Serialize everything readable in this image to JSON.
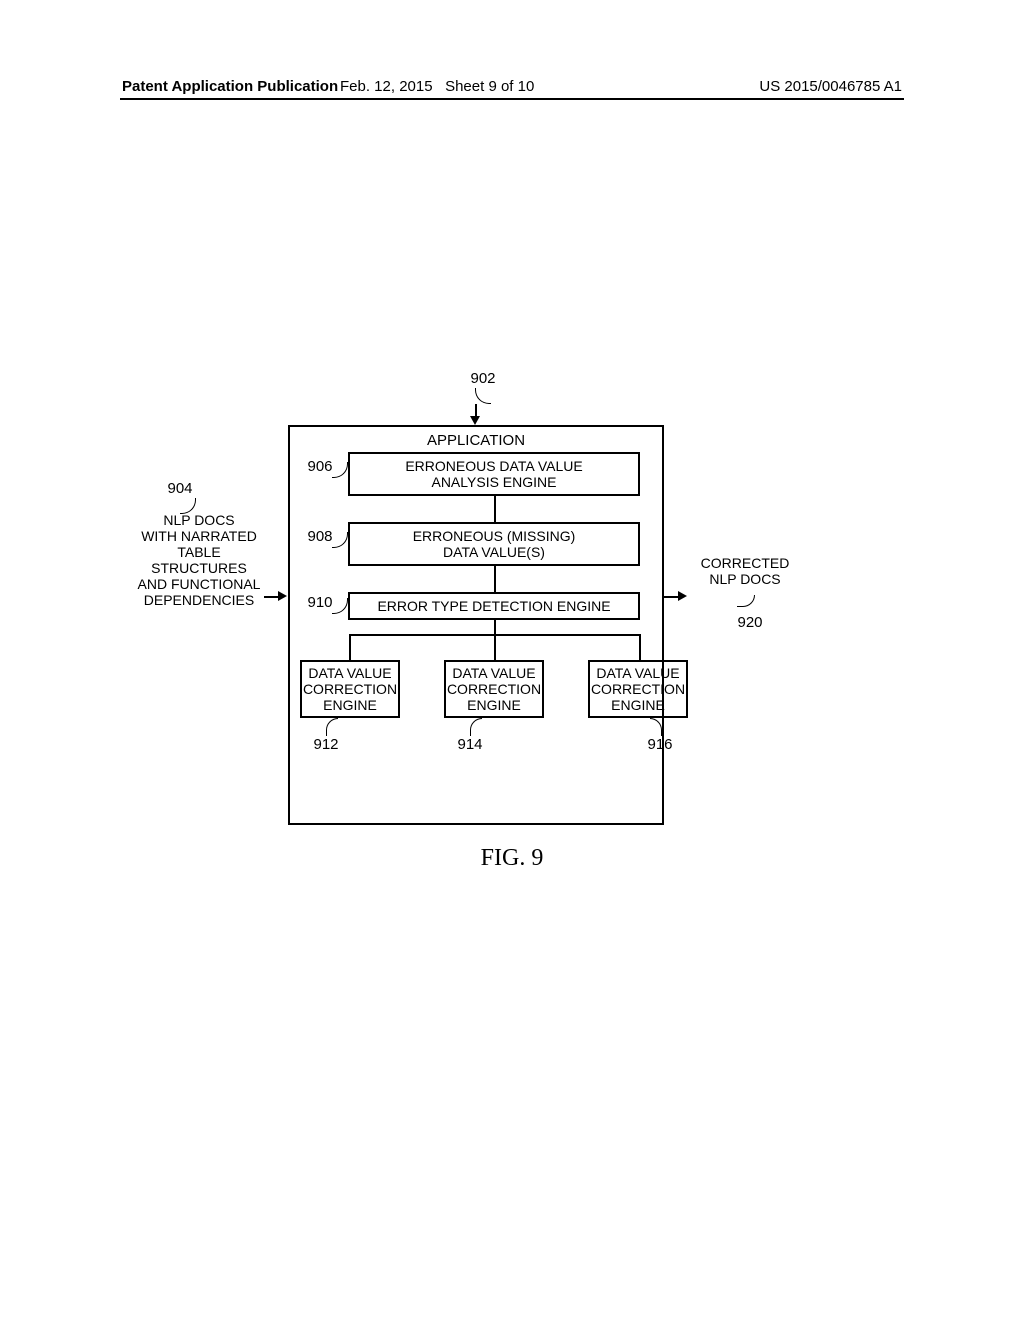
{
  "header": {
    "left": "Patent Application Publication",
    "mid": "Feb. 12, 2015   Sheet 9 of 10",
    "right": "US 2015/0046785 A1"
  },
  "figure": {
    "caption": "FIG. 9",
    "labels": {
      "n902": "902",
      "n904": "904",
      "n906": "906",
      "n908": "908",
      "n910": "910",
      "n912": "912",
      "n914": "914",
      "n916": "916",
      "n920": "920"
    },
    "text": {
      "application": "APPLICATION",
      "box906": "ERRONEOUS DATA VALUE\nANALYSIS ENGINE",
      "box908": "ERRONEOUS (MISSING)\nDATA VALUE(S)",
      "box910": "ERROR TYPE DETECTION ENGINE",
      "box9xx": "DATA VALUE\nCORRECTION\nENGINE",
      "input": "NLP DOCS\nWITH NARRATED\nTABLE\nSTRUCTURES\nAND FUNCTIONAL\nDEPENDENCIES",
      "output": "CORRECTED\nNLP DOCS"
    }
  }
}
